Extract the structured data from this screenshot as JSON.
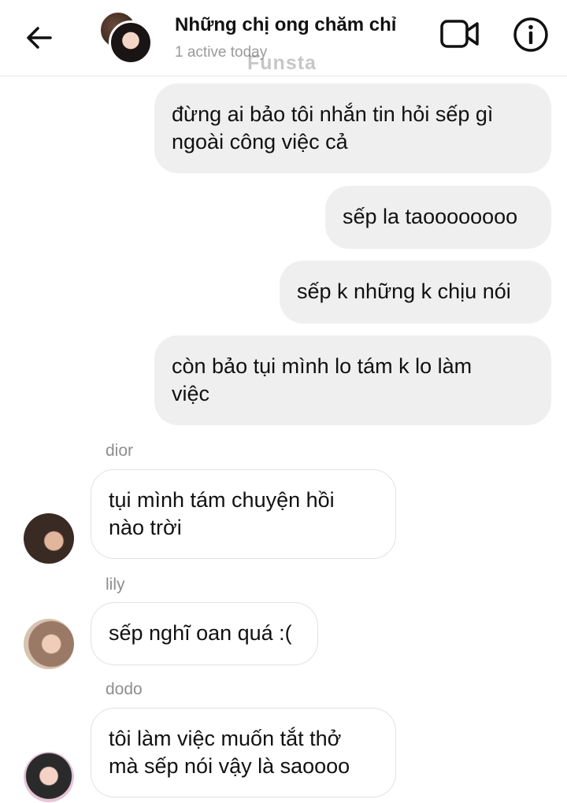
{
  "header": {
    "title": "Những chị ong chăm chỉ",
    "subtitle": "1 active today",
    "watermark": "Funsta",
    "icons": {
      "back": "arrow-left-icon",
      "video": "video-call-icon",
      "info": "info-icon"
    }
  },
  "messages": {
    "outgoing": [
      {
        "lines": [
          "đừng ai bảo tôi nhắn tin hỏi sếp gì",
          "ngoài công việc cả"
        ]
      },
      {
        "lines": [
          "sếp la taoooooooo"
        ]
      },
      {
        "lines": [
          "sếp k những k chịu nói"
        ]
      },
      {
        "lines": [
          "còn bảo tụi mình lo tám k lo làm",
          "việc"
        ]
      }
    ],
    "incoming": [
      {
        "sender": "dior",
        "lines": [
          "tụi mình tám chuyện hồi",
          "nào trời"
        ]
      },
      {
        "sender": "lily",
        "lines": [
          "sếp nghĩ oan quá :("
        ]
      },
      {
        "sender": "dodo",
        "lines": [
          "tôi làm việc muốn tắt thở",
          "mà sếp nói vậy là saoooo"
        ]
      }
    ]
  },
  "colors": {
    "outgoing_bubble": "#efefef",
    "incoming_border": "#e2e2e2",
    "muted_text": "#9a9a9a"
  }
}
